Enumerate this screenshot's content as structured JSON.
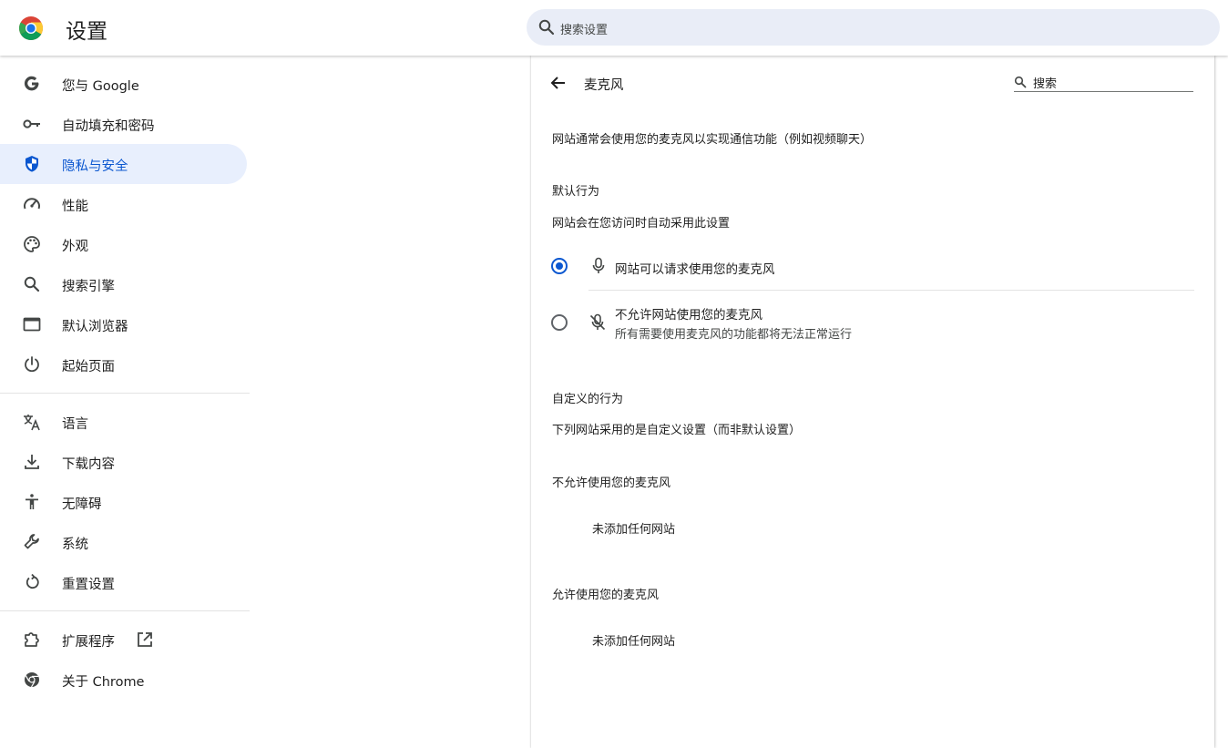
{
  "header": {
    "title": "设置",
    "search_placeholder": "搜索设置"
  },
  "sidebar": {
    "items": [
      {
        "label": "您与 Google",
        "icon": "google-g-icon"
      },
      {
        "label": "自动填充和密码",
        "icon": "key-icon"
      },
      {
        "label": "隐私与安全",
        "icon": "shield-icon",
        "active": true
      },
      {
        "label": "性能",
        "icon": "speedometer-icon"
      },
      {
        "label": "外观",
        "icon": "palette-icon"
      },
      {
        "label": "搜索引擎",
        "icon": "search-icon"
      },
      {
        "label": "默认浏览器",
        "icon": "browser-window-icon"
      },
      {
        "label": "起始页面",
        "icon": "power-icon"
      },
      {
        "label": "语言",
        "icon": "translate-icon"
      },
      {
        "label": "下载内容",
        "icon": "download-icon"
      },
      {
        "label": "无障碍",
        "icon": "accessibility-icon"
      },
      {
        "label": "系统",
        "icon": "wrench-icon"
      },
      {
        "label": "重置设置",
        "icon": "reset-icon"
      },
      {
        "label": "扩展程序",
        "icon": "puzzle-icon"
      },
      {
        "label": "关于 Chrome",
        "icon": "chrome-icon"
      }
    ]
  },
  "main": {
    "title": "麦克风",
    "search_label": "搜索",
    "description": "网站通常会使用您的麦克风以实现通信功能（例如视频聊天）",
    "default_heading": "默认行为",
    "default_desc": "网站会在您访问时自动采用此设置",
    "options": [
      {
        "label": "网站可以请求使用您的麦克风",
        "sublabel": "",
        "selected": true,
        "icon": "microphone-icon"
      },
      {
        "label": "不允许网站使用您的麦克风",
        "sublabel": "所有需要使用麦克风的功能都将无法正常运行",
        "selected": false,
        "icon": "microphone-off-icon"
      }
    ],
    "custom_heading": "自定义的行为",
    "custom_desc": "下列网站采用的是自定义设置（而非默认设置）",
    "blocked_heading": "不允许使用您的麦克风",
    "blocked_empty": "未添加任何网站",
    "allowed_heading": "允许使用您的麦克风",
    "allowed_empty": "未添加任何网站"
  },
  "colors": {
    "accent": "#0b57d0",
    "active_bg": "#e8effd",
    "search_bg": "#e9edf7"
  }
}
